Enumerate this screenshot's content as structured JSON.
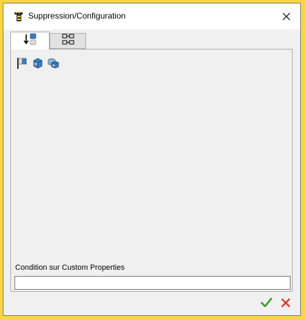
{
  "window": {
    "title": "Suppression/Configuration",
    "close_icon": "close-icon",
    "app_icon": "app-logo-icon"
  },
  "tabs": [
    {
      "icon": "sort-order-icon",
      "active": true
    },
    {
      "icon": "tree-structure-icon",
      "active": false
    }
  ],
  "toolbar": {
    "items": [
      {
        "icon": "flag-icon"
      },
      {
        "icon": "part-icon"
      },
      {
        "icon": "assembly-icon"
      }
    ]
  },
  "condition": {
    "label": "Condition sur Custom Properties",
    "value": "",
    "placeholder": ""
  },
  "footer": {
    "ok_icon": "checkmark-icon",
    "cancel_icon": "cancel-x-icon"
  },
  "colors": {
    "frame_accent": "#fcd63f",
    "ok_green": "#3f9a2e",
    "cancel_red": "#d83a2b",
    "part_blue": "#3a7ebf"
  }
}
